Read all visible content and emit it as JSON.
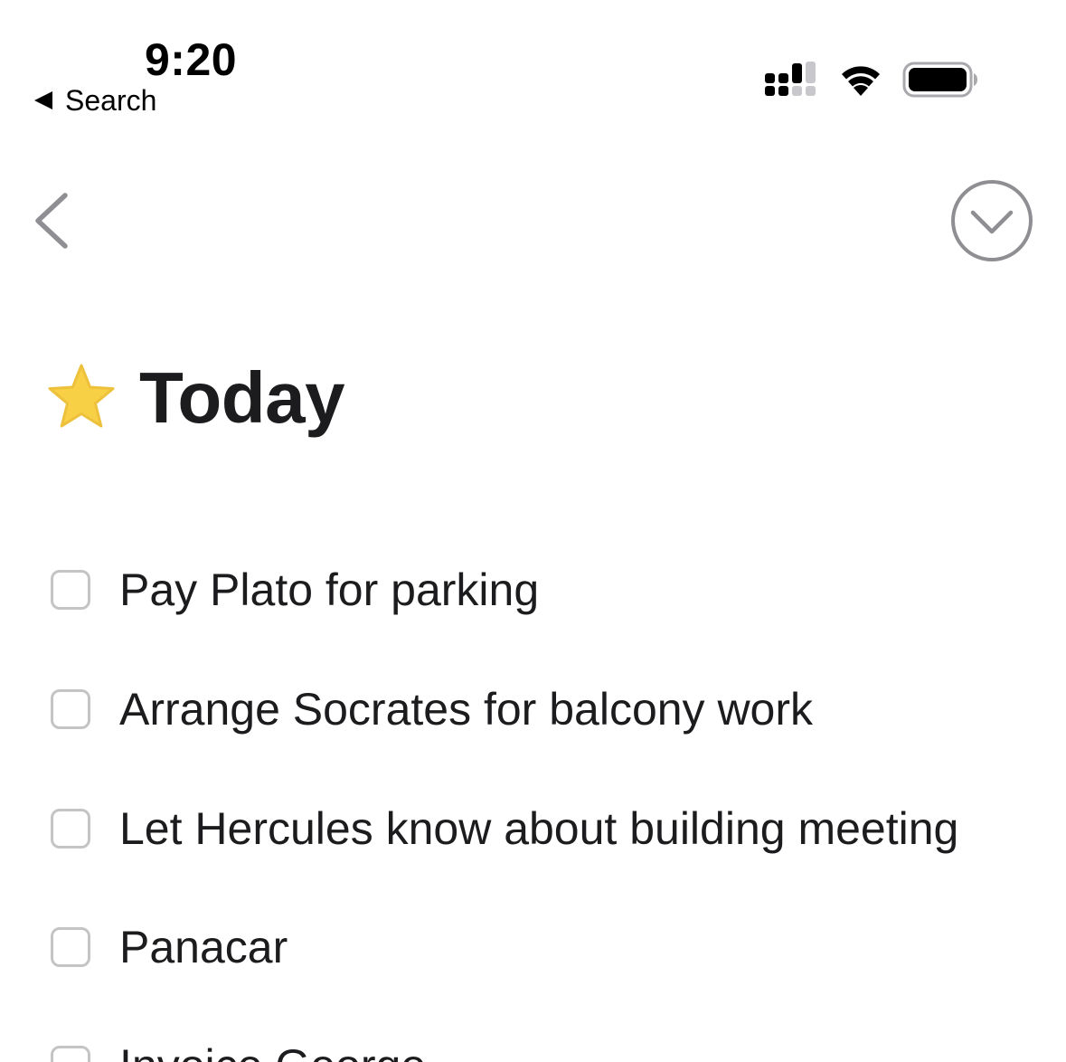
{
  "status_bar": {
    "time": "9:20",
    "back_label": "Search"
  },
  "header": {
    "title": "Today",
    "title_icon": "star-icon",
    "back_icon": "chevron-left-icon",
    "more_icon": "chevron-down-circle-icon"
  },
  "colors": {
    "star": "#f7d046",
    "checkbox_border": "#c4c4c6",
    "nav_icon": "#8e8e93",
    "text": "#1c1c1e"
  },
  "tasks": [
    {
      "label": "Pay Plato for parking",
      "checked": false
    },
    {
      "label": "Arrange Socrates for balcony work",
      "checked": false
    },
    {
      "label": "Let Hercules know about building meeting",
      "checked": false
    },
    {
      "label": "Panacar",
      "checked": false
    },
    {
      "label": "Invoice George",
      "checked": false
    }
  ]
}
